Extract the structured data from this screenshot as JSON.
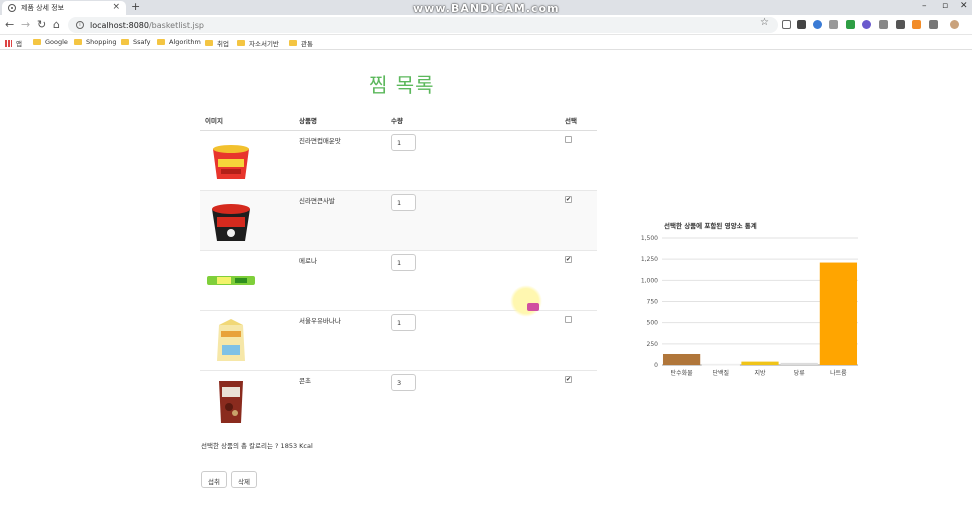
{
  "browser": {
    "tab_title": "제품 상세 정보",
    "tab_close": "×",
    "new_tab": "+",
    "watermark": "www.BANDICAM.com",
    "url_host": "localhost:8080",
    "url_path": "/basketlist.jsp",
    "bookmarks": [
      "앱",
      "Google",
      "Shopping",
      "Ssafy",
      "Algorithm",
      "취업",
      "자소서기반",
      "관통"
    ]
  },
  "page": {
    "title": "찜 목록",
    "columns": [
      "이미지",
      "상품명",
      "수량",
      "선택"
    ],
    "rows": [
      {
        "name": "진라면컵매운맛",
        "qty": "1",
        "checked": false
      },
      {
        "name": "신라면큰사발",
        "qty": "1",
        "checked": true
      },
      {
        "name": "메로나",
        "qty": "1",
        "checked": true
      },
      {
        "name": "서울우유바나나",
        "qty": "1",
        "checked": false
      },
      {
        "name": "콘초",
        "qty": "3",
        "checked": true
      }
    ],
    "summary": "선택한 상품의 총 칼로리는 ? 1853 Kcal",
    "buttons": {
      "intake": "섭취",
      "delete": "삭제"
    }
  },
  "chart_data": {
    "type": "bar",
    "title": "선택한 상품에 포함된 영양소 통계",
    "categories": [
      "탄수화물",
      "단백질",
      "지방",
      "당류",
      "나트륨"
    ],
    "values": [
      130,
      8,
      40,
      25,
      1210
    ],
    "colors": [
      "#b0763a",
      "#ffffff",
      "#f0c419",
      "#dcdcdc",
      "#ffa500"
    ],
    "ylim": [
      0,
      1500
    ],
    "yticks": [
      "0",
      "250",
      "500",
      "750",
      "1,000",
      "1,250",
      "1,500"
    ],
    "grid": true
  }
}
